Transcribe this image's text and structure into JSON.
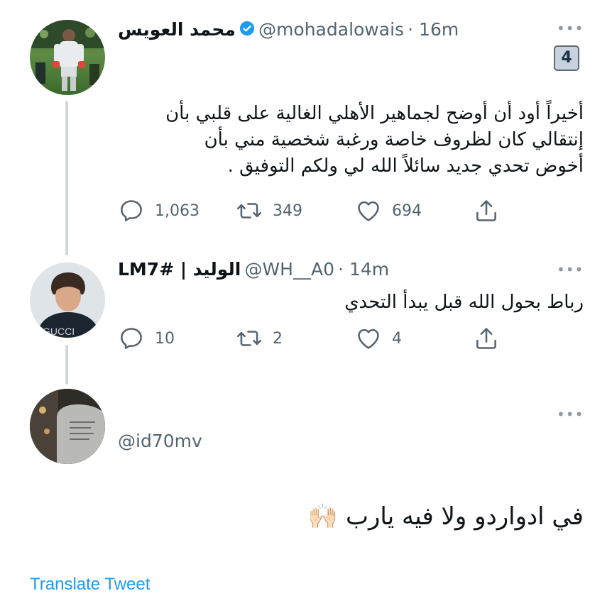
{
  "tweets": [
    {
      "name": "محمد العويس",
      "handle": "@mohadalowais",
      "time": "· 16m",
      "badge": "4",
      "text_lines": [
        "أخيراً أود أن أوضح لجماهير الأهلي الغالية على قلبي بأن",
        "إنتقالي كان لظروف خاصة ورغبة شخصية مني بأن",
        "أخوض تحدي جديد سائلاً الله لي ولكم التوفيق ."
      ],
      "replies": "1,063",
      "retweets": "349",
      "likes": "694"
    },
    {
      "name": "الوليد | LM7#",
      "handle": "@WH__A0",
      "time": "· 14m",
      "text": "رباط بحول الله قبل يبدأ التحدي",
      "replies": "10",
      "retweets": "2",
      "likes": "4"
    },
    {
      "handle": "@id70mv",
      "text": "في ادواردو ولا فيه يارب 🙌🏻"
    }
  ],
  "translate_label": "Translate Tweet",
  "more_glyph": "•••",
  "colors": {
    "link": "#1d9bf0",
    "verified": "#1d9bf0",
    "muted": "#536471"
  },
  "icons": [
    "verified-badge-icon",
    "reply-icon",
    "retweet-icon",
    "like-icon",
    "share-icon",
    "more-icon"
  ]
}
